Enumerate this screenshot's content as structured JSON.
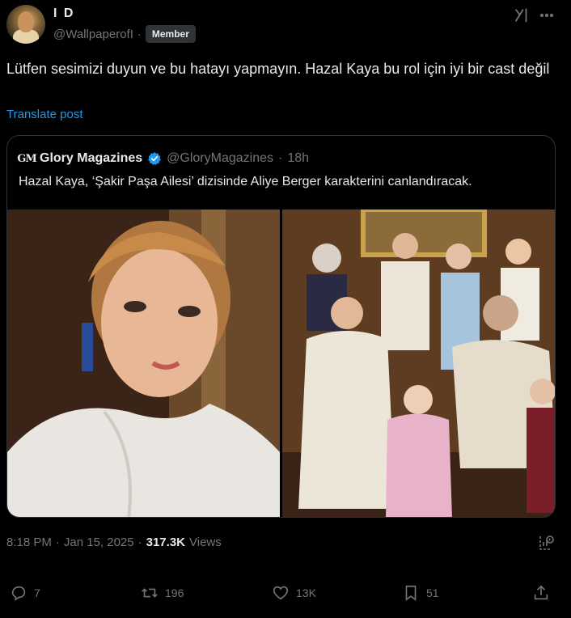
{
  "author": {
    "display_name": "I D",
    "handle": "@WallpaperofI",
    "separator": "·",
    "badge": "Member"
  },
  "tweet": {
    "text": "Lütfen sesimizi duyun ve bu hatayı yapmayın. Hazal Kaya bu rol için iyi bir cast değil",
    "translate_label": "Translate post"
  },
  "quote": {
    "logo_text": "GM",
    "display_name": "Glory Magazines",
    "handle": "@GloryMagazines",
    "separator": "·",
    "time": "18h",
    "text": "Hazal Kaya, ‘Şakir Paşa Ailesi’ dizisinde Aliye Berger karakterini canlandıracak."
  },
  "meta": {
    "time": "8:18 PM",
    "separator1": "·",
    "date": "Jan 15, 2025",
    "separator2": "·",
    "views_count": "317.3K",
    "views_label": "Views"
  },
  "actions": {
    "replies": "7",
    "reposts": "196",
    "likes": "13K",
    "bookmarks": "51"
  },
  "icons": [
    "grok-icon",
    "more-icon",
    "verified-badge-icon",
    "analytics-icon",
    "reply-icon",
    "repost-icon",
    "like-icon",
    "bookmark-icon",
    "share-icon"
  ],
  "colors": {
    "background": "#000000",
    "text": "#e7e9ea",
    "secondary": "#71767b",
    "link": "#1d9bf0",
    "border": "#2f3336"
  }
}
